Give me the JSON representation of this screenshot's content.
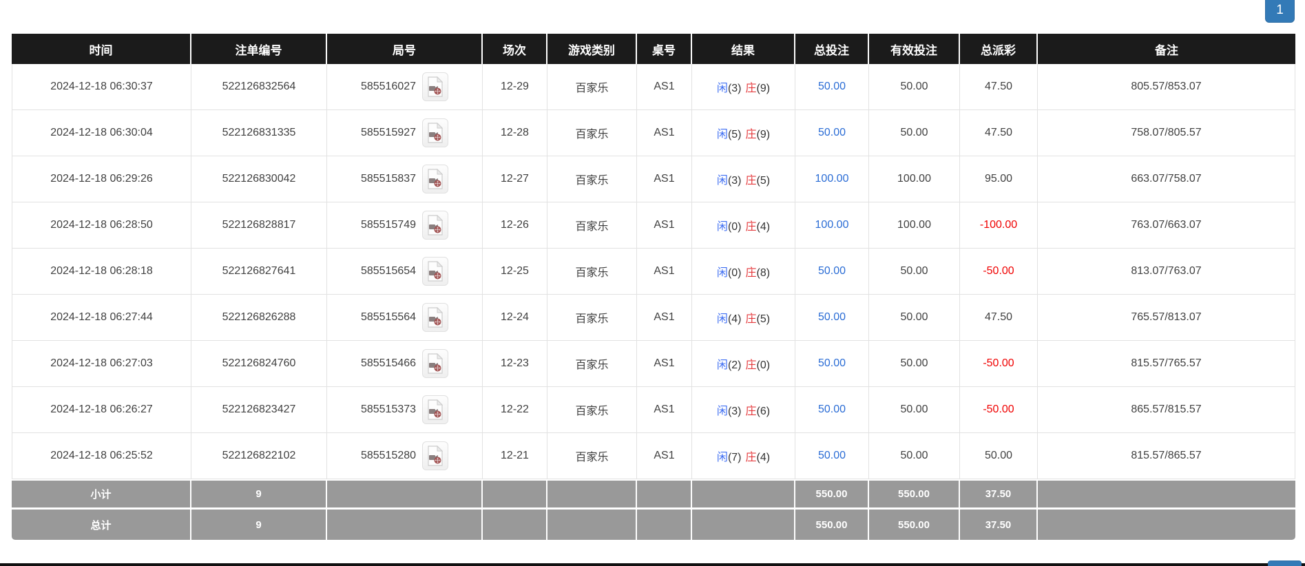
{
  "pagination": {
    "page": "1"
  },
  "icons": {
    "round_preview": "video-film-document-icon"
  },
  "colors": {
    "header_bg": "#1b1b1b",
    "totals_bg": "#999999",
    "accent_blue": "#337ab7",
    "link_blue": "#2a6cd5",
    "player_blue": "#3d6df2",
    "banker_red": "#e4393c",
    "negative_red": "#f00000"
  },
  "table": {
    "headers": {
      "time": "时间",
      "bet_id": "注单编号",
      "round": "局号",
      "session": "场次",
      "game_type": "游戏类别",
      "table_no": "桌号",
      "result": "结果",
      "total_bet": "总投注",
      "valid_bet": "有效投注",
      "payout": "总派彩",
      "remark": "备注"
    },
    "rows": [
      {
        "time": "2024-12-18 06:30:37",
        "bet_id": "522126832564",
        "round_id": "585516027",
        "session": "12-29",
        "game": "百家乐",
        "table_no": "AS1",
        "player_label": "闲",
        "player_score": "(3)",
        "banker_label": "庄",
        "banker_score": "(9)",
        "total_bet": "50.00",
        "valid_bet": "50.00",
        "payout": "47.50",
        "remark": "805.57/853.07"
      },
      {
        "time": "2024-12-18 06:30:04",
        "bet_id": "522126831335",
        "round_id": "585515927",
        "session": "12-28",
        "game": "百家乐",
        "table_no": "AS1",
        "player_label": "闲",
        "player_score": "(5)",
        "banker_label": "庄",
        "banker_score": "(9)",
        "total_bet": "50.00",
        "valid_bet": "50.00",
        "payout": "47.50",
        "remark": "758.07/805.57"
      },
      {
        "time": "2024-12-18 06:29:26",
        "bet_id": "522126830042",
        "round_id": "585515837",
        "session": "12-27",
        "game": "百家乐",
        "table_no": "AS1",
        "player_label": "闲",
        "player_score": "(3)",
        "banker_label": "庄",
        "banker_score": "(5)",
        "total_bet": "100.00",
        "valid_bet": "100.00",
        "payout": "95.00",
        "remark": "663.07/758.07"
      },
      {
        "time": "2024-12-18 06:28:50",
        "bet_id": "522126828817",
        "round_id": "585515749",
        "session": "12-26",
        "game": "百家乐",
        "table_no": "AS1",
        "player_label": "闲",
        "player_score": "(0)",
        "banker_label": "庄",
        "banker_score": "(4)",
        "total_bet": "100.00",
        "valid_bet": "100.00",
        "payout": "-100.00",
        "remark": "763.07/663.07"
      },
      {
        "time": "2024-12-18 06:28:18",
        "bet_id": "522126827641",
        "round_id": "585515654",
        "session": "12-25",
        "game": "百家乐",
        "table_no": "AS1",
        "player_label": "闲",
        "player_score": "(0)",
        "banker_label": "庄",
        "banker_score": "(8)",
        "total_bet": "50.00",
        "valid_bet": "50.00",
        "payout": "-50.00",
        "remark": "813.07/763.07"
      },
      {
        "time": "2024-12-18 06:27:44",
        "bet_id": "522126826288",
        "round_id": "585515564",
        "session": "12-24",
        "game": "百家乐",
        "table_no": "AS1",
        "player_label": "闲",
        "player_score": "(4)",
        "banker_label": "庄",
        "banker_score": "(5)",
        "total_bet": "50.00",
        "valid_bet": "50.00",
        "payout": "47.50",
        "remark": "765.57/813.07"
      },
      {
        "time": "2024-12-18 06:27:03",
        "bet_id": "522126824760",
        "round_id": "585515466",
        "session": "12-23",
        "game": "百家乐",
        "table_no": "AS1",
        "player_label": "闲",
        "player_score": "(2)",
        "banker_label": "庄",
        "banker_score": "(0)",
        "total_bet": "50.00",
        "valid_bet": "50.00",
        "payout": "-50.00",
        "remark": "815.57/765.57"
      },
      {
        "time": "2024-12-18 06:26:27",
        "bet_id": "522126823427",
        "round_id": "585515373",
        "session": "12-22",
        "game": "百家乐",
        "table_no": "AS1",
        "player_label": "闲",
        "player_score": "(3)",
        "banker_label": "庄",
        "banker_score": "(6)",
        "total_bet": "50.00",
        "valid_bet": "50.00",
        "payout": "-50.00",
        "remark": "865.57/815.57"
      },
      {
        "time": "2024-12-18 06:25:52",
        "bet_id": "522126822102",
        "round_id": "585515280",
        "session": "12-21",
        "game": "百家乐",
        "table_no": "AS1",
        "player_label": "闲",
        "player_score": "(7)",
        "banker_label": "庄",
        "banker_score": "(4)",
        "total_bet": "50.00",
        "valid_bet": "50.00",
        "payout": "50.00",
        "remark": "815.57/865.57"
      }
    ],
    "subtotal": {
      "label": "小计",
      "count": "9",
      "total_bet": "550.00",
      "valid_bet": "550.00",
      "payout": "37.50"
    },
    "total": {
      "label": "总计",
      "count": "9",
      "total_bet": "550.00",
      "valid_bet": "550.00",
      "payout": "37.50"
    }
  }
}
